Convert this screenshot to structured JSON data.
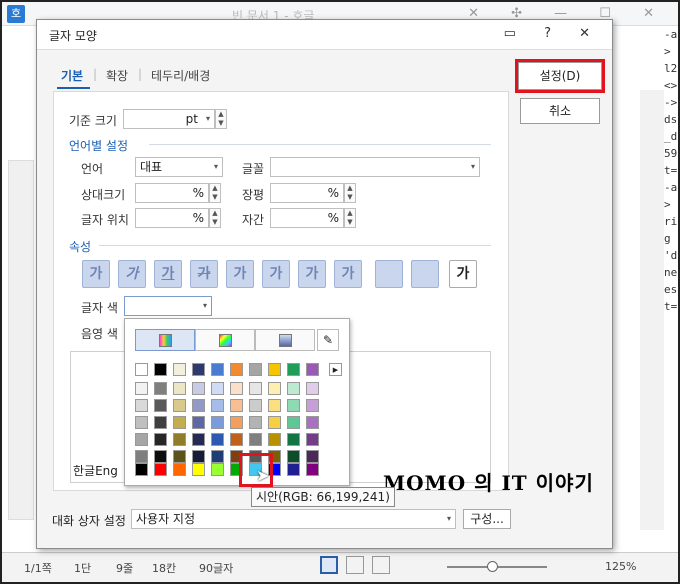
{
  "app": {
    "logo": "호",
    "title": "빈 문서 1 - 호글",
    "controls": "✕ ✣ — ☐ ✕"
  },
  "right_doc_lines": [
    "-a",
    ">",
    "",
    "l2",
    "<>",
    "->",
    "ds",
    "_d",
    "59",
    "t=",
    "-a",
    ">",
    "",
    "",
    "",
    "",
    "",
    "",
    "ri",
    "",
    "",
    "",
    "g",
    "'d",
    "ne",
    "",
    "",
    "",
    "",
    "es",
    "t="
  ],
  "statusbar": {
    "page": "1/1쪽",
    "col": "1단",
    "line": "9줄",
    "pos": "18칸",
    "chars": "90글자",
    "zoom": "125%"
  },
  "dialog": {
    "title": "글자 모양",
    "title_buttons": "▭ ? ✕",
    "tabs": [
      "기본",
      "확장",
      "테두리/배경"
    ],
    "set_button": "설정(D)",
    "cancel_button": "취소",
    "base_size_label": "기준 크기",
    "base_size_unit": "pt",
    "lang_section": "언어별 설정",
    "lang_label": "언어",
    "lang_value": "대표",
    "font_label": "글꼴",
    "rel_size_label": "상대크기",
    "width_label": "장평",
    "pos_label": "글자 위치",
    "spacing_label": "자간",
    "percent": "%",
    "attr_section": "속성",
    "attr_glyphs": [
      "가",
      "가",
      "가",
      "가",
      "가",
      "가",
      "가",
      "가",
      "",
      "",
      "가"
    ],
    "text_color_label": "글자 색",
    "shade_color_label": "음영 색",
    "preview_text": "한글Eng",
    "dialog_setting_label": "대화 상자 설정",
    "dialog_setting_value": "사용자 지정",
    "compose_button": "구성..."
  },
  "palette": {
    "eyedropper_icon": "eyedropper-icon",
    "top_row": [
      "#ffffff",
      "#000000",
      "#f2f0dc",
      "#2e3a6e",
      "#4a7bd0",
      "#f28a30",
      "#a5a5a5",
      "#f6c400",
      "#1f9e5a",
      "#9b59b6"
    ],
    "shades": [
      [
        "#f2f2f2",
        "#7f7f7f",
        "#ece6c6",
        "#c7cbe3",
        "#d0dcf3",
        "#fbdfc9",
        "#e6e6e6",
        "#fdefb0",
        "#bfead2",
        "#e0cdea"
      ],
      [
        "#d9d9d9",
        "#595959",
        "#d9c98d",
        "#9299c7",
        "#a6bde8",
        "#f7bf93",
        "#cccccc",
        "#fbdf80",
        "#8fd9b3",
        "#c59fd5"
      ],
      [
        "#bfbfbf",
        "#3f3f3f",
        "#c3ad4e",
        "#5e68a9",
        "#7a9bdc",
        "#f49f5e",
        "#b3b3b3",
        "#f9cf42",
        "#5fc795",
        "#a971c1"
      ],
      [
        "#a6a6a6",
        "#262626",
        "#8f7d2a",
        "#222a55",
        "#2d5ab0",
        "#c0601a",
        "#7f7f7f",
        "#b89100",
        "#157443",
        "#733d8a"
      ],
      [
        "#7f7f7f",
        "#0d0d0d",
        "#5e521b",
        "#161c38",
        "#1e3c75",
        "#803f11",
        "#595959",
        "#7a6000",
        "#0e4d2c",
        "#4d285c"
      ]
    ],
    "standard_row": [
      "#000000",
      "#ff0000",
      "#ff6600",
      "#ffff00",
      "#99ff33",
      "#00aa00",
      "#42c7f1",
      "#0000ff",
      "#1f1f8f",
      "#800080"
    ],
    "tooltip": "시안(RGB: 66,199,241)"
  },
  "watermark": "MOMO 의 IT 이야기"
}
